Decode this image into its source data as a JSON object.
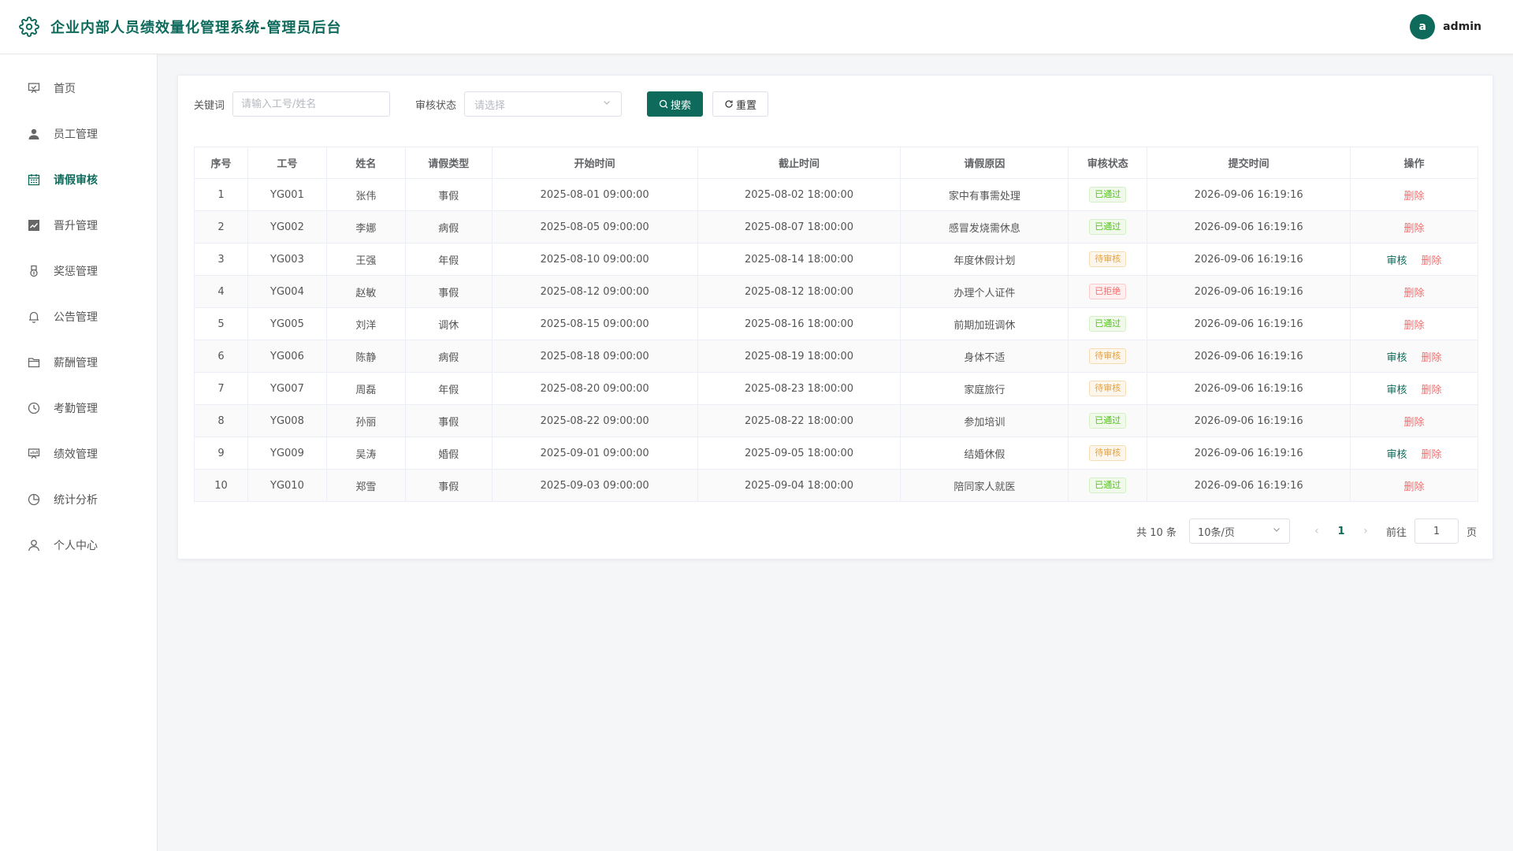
{
  "header": {
    "title": "企业内部人员绩效量化管理系统-管理员后台",
    "avatar_letter": "a",
    "username": "admin"
  },
  "sidebar": {
    "items": [
      {
        "label": "首页",
        "icon": "home-board-icon"
      },
      {
        "label": "员工管理",
        "icon": "user-icon"
      },
      {
        "label": "请假审核",
        "icon": "calendar-icon",
        "active": true
      },
      {
        "label": "晋升管理",
        "icon": "chart-up-icon"
      },
      {
        "label": "奖惩管理",
        "icon": "medal-icon"
      },
      {
        "label": "公告管理",
        "icon": "bell-icon"
      },
      {
        "label": "薪酬管理",
        "icon": "folder-icon"
      },
      {
        "label": "考勤管理",
        "icon": "clock-icon"
      },
      {
        "label": "绩效管理",
        "icon": "presentation-icon"
      },
      {
        "label": "统计分析",
        "icon": "pie-chart-icon"
      },
      {
        "label": "个人中心",
        "icon": "user-outline-icon"
      }
    ]
  },
  "filters": {
    "keyword_label": "关键词",
    "keyword_placeholder": "请输入工号/姓名",
    "status_label": "审核状态",
    "status_placeholder": "请选择",
    "search_label": "搜索",
    "reset_label": "重置"
  },
  "table": {
    "headers": [
      "序号",
      "工号",
      "姓名",
      "请假类型",
      "开始时间",
      "截止时间",
      "请假原因",
      "审核状态",
      "提交时间",
      "操作"
    ],
    "rows": [
      {
        "no": "1",
        "id": "YG001",
        "name": "张伟",
        "type": "事假",
        "start": "2025-08-01 09:00:00",
        "end": "2025-08-02 18:00:00",
        "reason": "家中有事需处理",
        "status": "已通过",
        "submit": "2026-09-06 16:19:16"
      },
      {
        "no": "2",
        "id": "YG002",
        "name": "李娜",
        "type": "病假",
        "start": "2025-08-05 09:00:00",
        "end": "2025-08-07 18:00:00",
        "reason": "感冒发烧需休息",
        "status": "已通过",
        "submit": "2026-09-06 16:19:16"
      },
      {
        "no": "3",
        "id": "YG003",
        "name": "王强",
        "type": "年假",
        "start": "2025-08-10 09:00:00",
        "end": "2025-08-14 18:00:00",
        "reason": "年度休假计划",
        "status": "待审核",
        "submit": "2026-09-06 16:19:16"
      },
      {
        "no": "4",
        "id": "YG004",
        "name": "赵敏",
        "type": "事假",
        "start": "2025-08-12 09:00:00",
        "end": "2025-08-12 18:00:00",
        "reason": "办理个人证件",
        "status": "已拒绝",
        "submit": "2026-09-06 16:19:16"
      },
      {
        "no": "5",
        "id": "YG005",
        "name": "刘洋",
        "type": "调休",
        "start": "2025-08-15 09:00:00",
        "end": "2025-08-16 18:00:00",
        "reason": "前期加班调休",
        "status": "已通过",
        "submit": "2026-09-06 16:19:16"
      },
      {
        "no": "6",
        "id": "YG006",
        "name": "陈静",
        "type": "病假",
        "start": "2025-08-18 09:00:00",
        "end": "2025-08-19 18:00:00",
        "reason": "身体不适",
        "status": "待审核",
        "submit": "2026-09-06 16:19:16"
      },
      {
        "no": "7",
        "id": "YG007",
        "name": "周磊",
        "type": "年假",
        "start": "2025-08-20 09:00:00",
        "end": "2025-08-23 18:00:00",
        "reason": "家庭旅行",
        "status": "待审核",
        "submit": "2026-09-06 16:19:16"
      },
      {
        "no": "8",
        "id": "YG008",
        "name": "孙丽",
        "type": "事假",
        "start": "2025-08-22 09:00:00",
        "end": "2025-08-22 18:00:00",
        "reason": "参加培训",
        "status": "已通过",
        "submit": "2026-09-06 16:19:16"
      },
      {
        "no": "9",
        "id": "YG009",
        "name": "吴涛",
        "type": "婚假",
        "start": "2025-09-01 09:00:00",
        "end": "2025-09-05 18:00:00",
        "reason": "结婚休假",
        "status": "待审核",
        "submit": "2026-09-06 16:19:16"
      },
      {
        "no": "10",
        "id": "YG010",
        "name": "郑雪",
        "type": "事假",
        "start": "2025-09-03 09:00:00",
        "end": "2025-09-04 18:00:00",
        "reason": "陪同家人就医",
        "status": "已通过",
        "submit": "2026-09-06 16:19:16"
      }
    ],
    "action_audit": "审核",
    "action_delete": "删除"
  },
  "pagination": {
    "total": "共 10 条",
    "page_size": "10条/页",
    "current_page": "1",
    "goto_label": "前往",
    "goto_value": "1",
    "page_suffix": "页"
  },
  "colors": {
    "accent": "#0e6b5c",
    "approved": "#52c41a",
    "pending": "#e6a23c",
    "rejected": "#f56c6c"
  }
}
